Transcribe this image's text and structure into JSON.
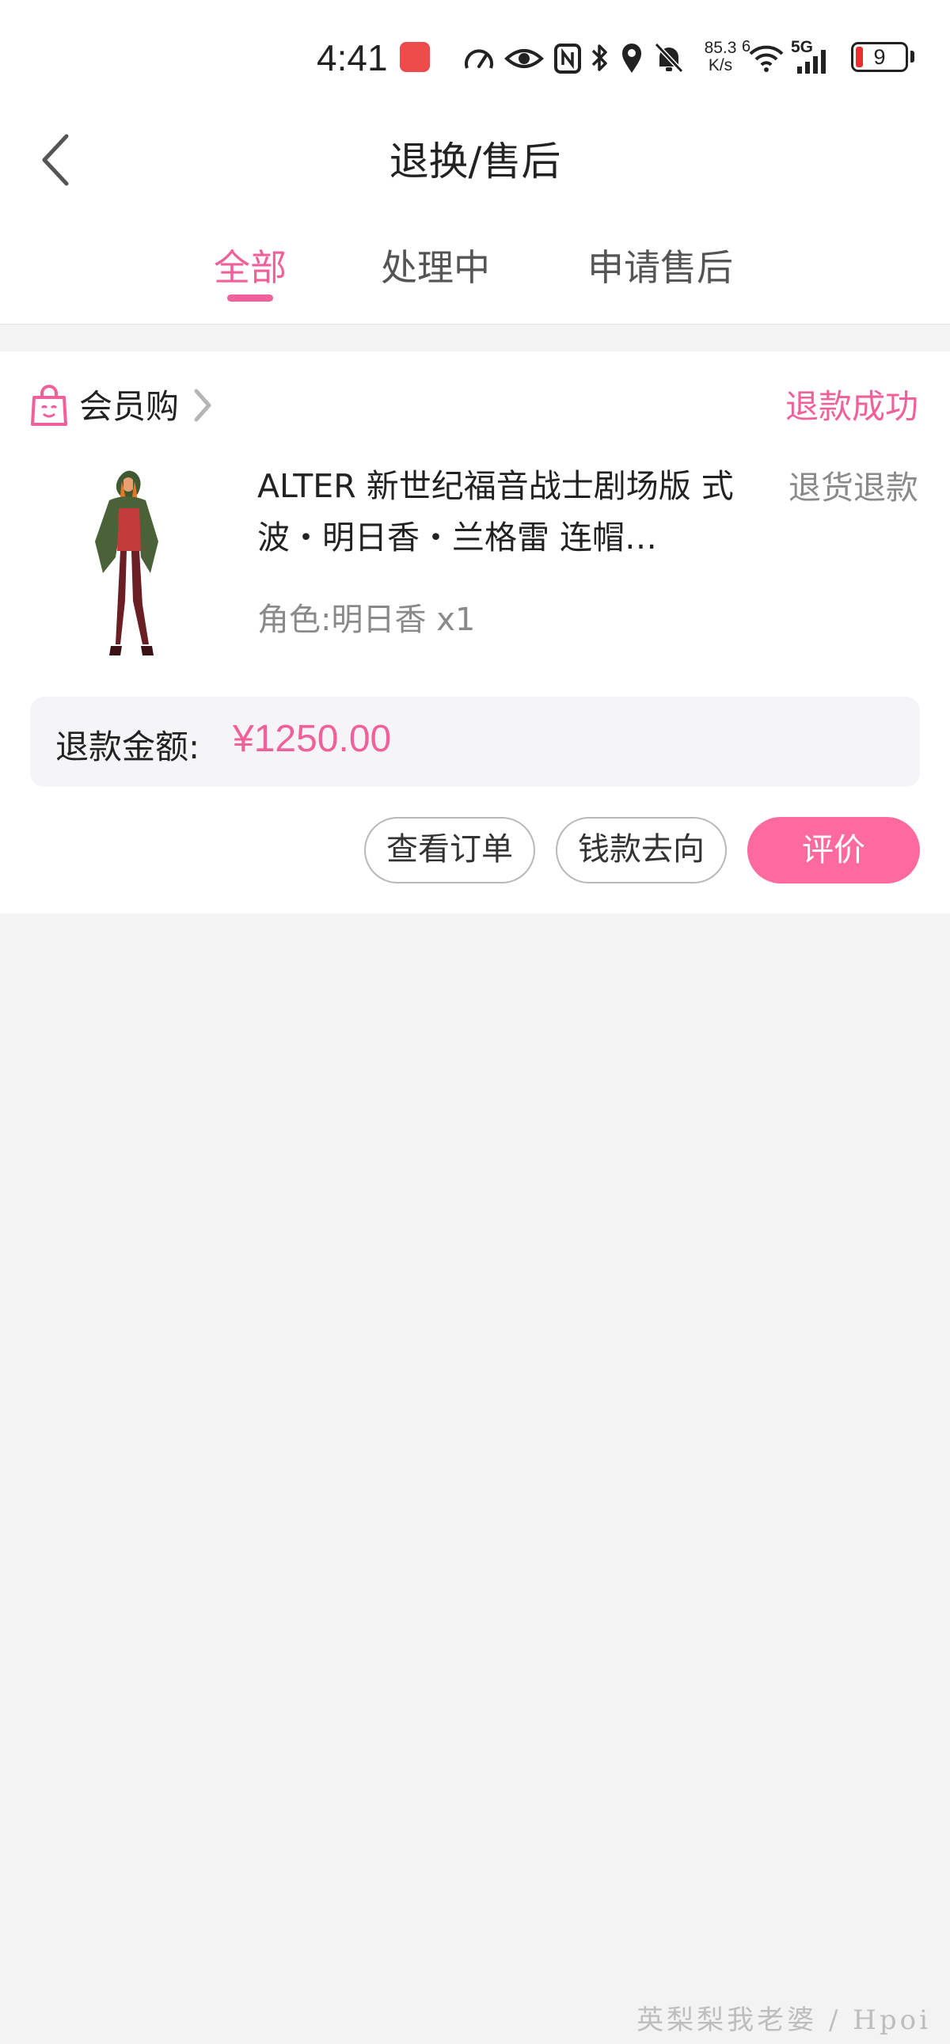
{
  "status_bar": {
    "time": "4:41",
    "net_speed_value": "85.3",
    "net_speed_unit": "K/s",
    "wifi_badge": "6",
    "cell_badge": "5G",
    "battery_level": "9"
  },
  "header": {
    "title": "退换/售后",
    "back_icon": "chevron-left-icon"
  },
  "tabs": [
    {
      "label": "全部",
      "active": true
    },
    {
      "label": "处理中",
      "active": false
    },
    {
      "label": "申请售后",
      "active": false
    }
  ],
  "order": {
    "shop_name": "会员购",
    "status": "退款成功",
    "product_title": "ALTER 新世纪福音战士剧场版 式波・明日香・兰格雷 连帽…",
    "spec": "角色:明日香 x1",
    "return_type": "退货退款",
    "refund_label": "退款金额:",
    "refund_amount": "¥1250.00",
    "buttons": {
      "view_order": "查看订单",
      "money_flow": "钱款去向",
      "review": "评价"
    }
  },
  "watermark": "英梨梨我老婆 / Hpoi",
  "colors": {
    "accent": "#f0609a",
    "primary_button": "#ff6a9e",
    "background": "#f3f3f4"
  }
}
